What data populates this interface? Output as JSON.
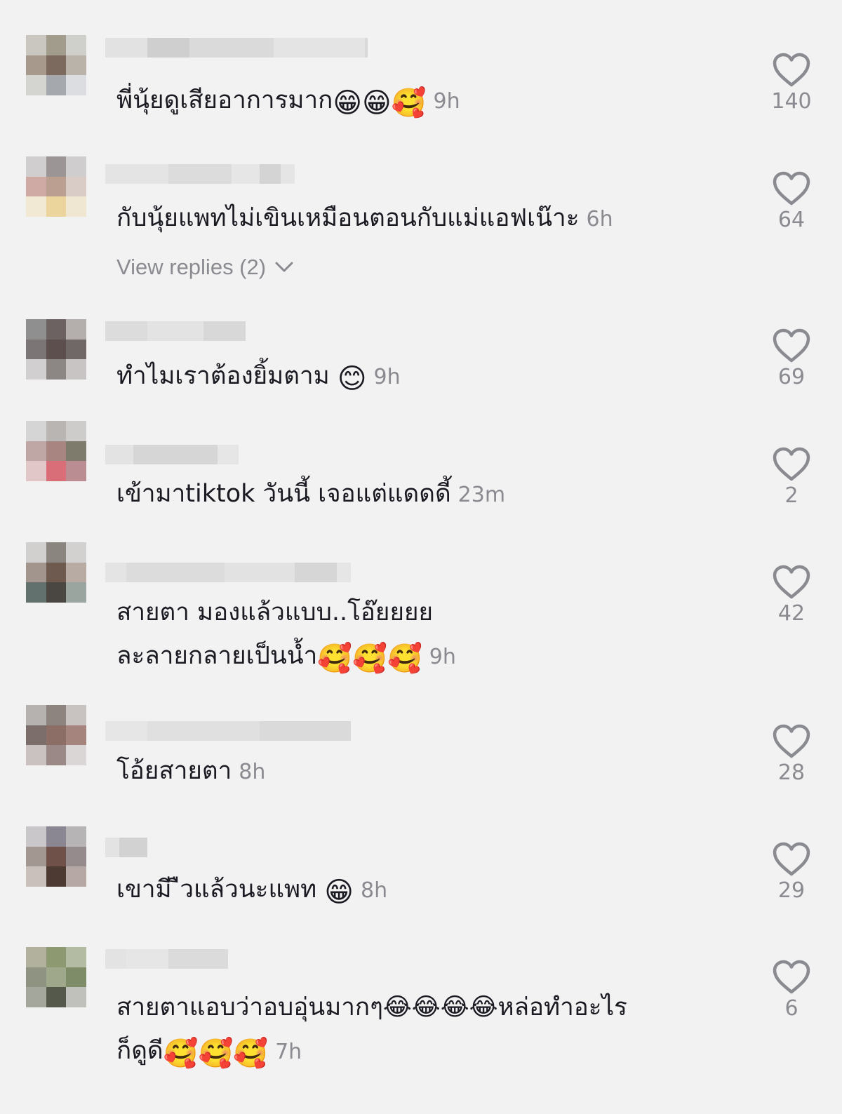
{
  "comments": [
    {
      "text": "พี่นุ้ยดูเสียอาการมาก",
      "emojis": [
        "😁",
        "😁",
        "🥰"
      ],
      "time": "9h",
      "likes": "140"
    },
    {
      "text": "กับนุ้ยแพทไม่เขินเหมือนตอนกับแม่แอฟเน๊าะ",
      "emojis": [],
      "time": "6h",
      "likes": "64"
    },
    {
      "text": "ทำไมเราต้องยิ้มตาม",
      "emojis": [
        "😊"
      ],
      "time": "9h",
      "likes": "69"
    },
    {
      "text": "เข้ามาtiktok วันนี้ เจอแต่แดดดี้",
      "emojis": [],
      "time": "23m",
      "likes": "2"
    },
    {
      "text_line1": "สายตา มองแล้วแบบ..โอ๊ยยยย",
      "text": "ละลายกลายเป็นน้ำ",
      "emojis": [
        "🥰",
        "🥰",
        "🥰"
      ],
      "time": "9h",
      "likes": "42"
    },
    {
      "text": "โอ้ยสายตา",
      "emojis": [],
      "time": "8h",
      "likes": "28"
    },
    {
      "text": "เขามี ืวแล้วนะแพท",
      "emojis": [
        "😁"
      ],
      "time": "8h",
      "likes": "29"
    },
    {
      "text_line1": "สายตาแอบว่าอบอุ่นมากๆ😂😂😂😂หล่อทำอะไร",
      "text": "ก็ดูดี",
      "emojis": [
        "🥰",
        "🥰",
        "🥰"
      ],
      "time": "7h",
      "likes": "6"
    }
  ],
  "view_replies": {
    "label": "View replies (2)"
  },
  "icons": {
    "like": "heart-outline-icon",
    "expand": "chevron-down-icon"
  }
}
